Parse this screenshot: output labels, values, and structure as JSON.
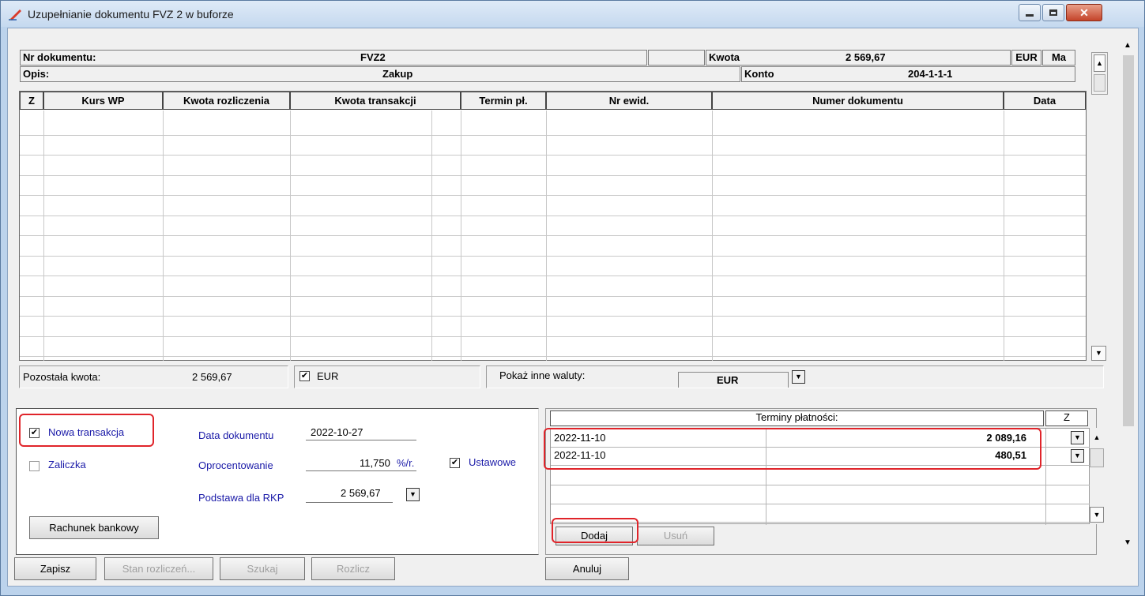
{
  "window": {
    "title": "Uzupełnianie dokumentu FVZ 2 w buforze"
  },
  "header": {
    "nr_label": "Nr dokumentu:",
    "nr_value": "FVZ2",
    "kwota_label": "Kwota",
    "kwota_value": "2 569,67",
    "currency": "EUR",
    "side": "Ma",
    "opis_label": "Opis:",
    "opis_value": "Zakup",
    "konto_label": "Konto",
    "konto_value": "204-1-1-1"
  },
  "grid": {
    "columns": [
      "Z",
      "Kurs WP",
      "Kwota rozliczenia",
      "Kwota transakcji",
      "Termin pł.",
      "Nr ewid.",
      "Numer dokumentu",
      "Data"
    ]
  },
  "summary": {
    "pozostala_label": "Pozostała kwota:",
    "pozostala_value": "2 569,67",
    "eur_checkbox_label": "EUR",
    "pokaz_label": "Pokaż inne waluty:",
    "currency_select": "EUR"
  },
  "form": {
    "nowa_transakcja": "Nowa transakcja",
    "zaliczka": "Zaliczka",
    "data_dokumentu_label": "Data dokumentu",
    "data_dokumentu_value": "2022-10-27",
    "oprocentowanie_label": "Oprocentowanie",
    "oprocentowanie_value": "11,750",
    "oprocentowanie_unit": "%/r.",
    "ustawowe": "Ustawowe",
    "podstawa_label": "Podstawa dla RKP",
    "podstawa_value": "2 569,67",
    "rachunek_button": "Rachunek bankowy"
  },
  "terminy": {
    "header": "Terminy płatności:",
    "z_header": "Z",
    "rows": [
      {
        "date": "2022-11-10",
        "amount": "2 089,16"
      },
      {
        "date": "2022-11-10",
        "amount": "480,51"
      }
    ],
    "dodaj": "Dodaj",
    "usun": "Usuń"
  },
  "footer": {
    "zapisz": "Zapisz",
    "stan": "Stan rozliczeń...",
    "szukaj": "Szukaj",
    "rozlicz": "Rozlicz",
    "anuluj": "Anuluj"
  }
}
